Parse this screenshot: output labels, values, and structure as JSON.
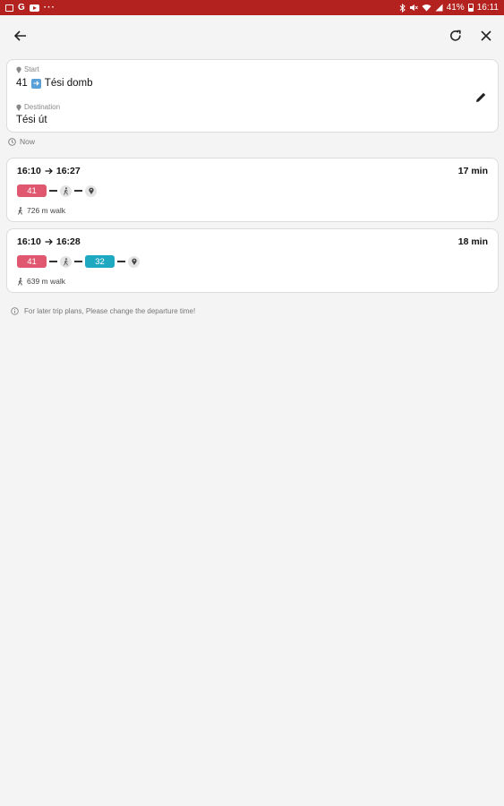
{
  "status_bar": {
    "left_icons": [
      "gallery-icon",
      "google-icon",
      "youtube-icon",
      "more-dots-icon"
    ],
    "more": "···",
    "battery": "41%",
    "time": "16:11"
  },
  "route": {
    "start_label": "Start",
    "start_line": "41",
    "start_place": "Tési domb",
    "destination_label": "Destination",
    "destination_place": "Tési út"
  },
  "departure": {
    "label": "Now"
  },
  "trips": [
    {
      "depart": "16:10",
      "arrive": "16:27",
      "duration": "17 min",
      "legs": [
        {
          "type": "bus",
          "label": "41",
          "color": "#e05770"
        },
        {
          "type": "walk"
        },
        {
          "type": "destination"
        }
      ],
      "walk": "726 m walk"
    },
    {
      "depart": "16:10",
      "arrive": "16:28",
      "duration": "18 min",
      "legs": [
        {
          "type": "bus",
          "label": "41",
          "color": "#e05770"
        },
        {
          "type": "walk"
        },
        {
          "type": "bus",
          "label": "32",
          "color": "#1fa9c1"
        },
        {
          "type": "destination"
        }
      ],
      "walk": "639 m walk"
    }
  ],
  "note": "For later trip plans, Please change the departure time!",
  "colors": {
    "status_bar": "#b3221f",
    "line_41": "#e05770",
    "line_32": "#1fa9c1"
  }
}
